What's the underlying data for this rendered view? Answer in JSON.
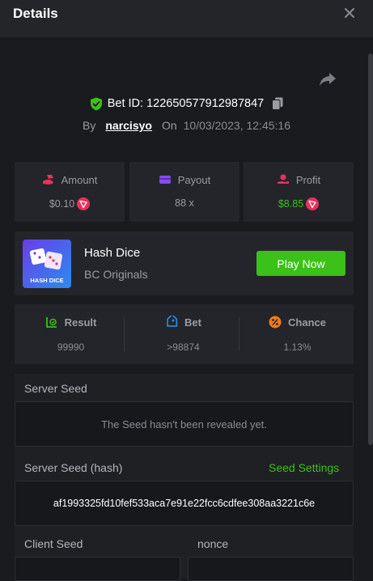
{
  "header": {
    "title": "Details"
  },
  "bet": {
    "id_text": "Bet ID: 122650577912987847",
    "by_label": "By",
    "username": "narcisyo",
    "on_label": "On",
    "datetime": "10/03/2023, 12:45:16"
  },
  "stats": [
    {
      "label": "Amount",
      "value": "$0.10",
      "icon": "money-hand-icon",
      "currency_icon": "trx-coin-icon"
    },
    {
      "label": "Payout",
      "value": "88 x",
      "icon": "wallet-card-icon"
    },
    {
      "label": "Profit",
      "value": "$8.85",
      "icon": "profit-hand-icon",
      "currency_icon": "trx-coin-icon"
    }
  ],
  "game": {
    "thumb_text": "HASH DICE",
    "name": "Hash Dice",
    "provider": "BC Originals",
    "play_label": "Play Now"
  },
  "result": [
    {
      "label": "Result",
      "value": "99990",
      "icon": "chart-check-icon"
    },
    {
      "label": "Bet",
      "value": ">98874",
      "icon": "tag-icon"
    },
    {
      "label": "Chance",
      "value": "1.13%",
      "icon": "percent-icon"
    }
  ],
  "seeds": {
    "server_seed_label": "Server Seed",
    "server_seed_value": "The Seed hasn't been revealed yet.",
    "server_hash_label": "Server Seed (hash)",
    "seed_settings_label": "Seed Settings",
    "server_hash_value": "af1993325fd10fef533aca7e91e22fcc6cdfee308aa3221c6e",
    "client_seed_label": "Client Seed",
    "nonce_label": "nonce"
  },
  "colors": {
    "accent_green": "#3bc117",
    "background": "#1a1b1e",
    "panel": "#24252a",
    "header": "#242529"
  }
}
